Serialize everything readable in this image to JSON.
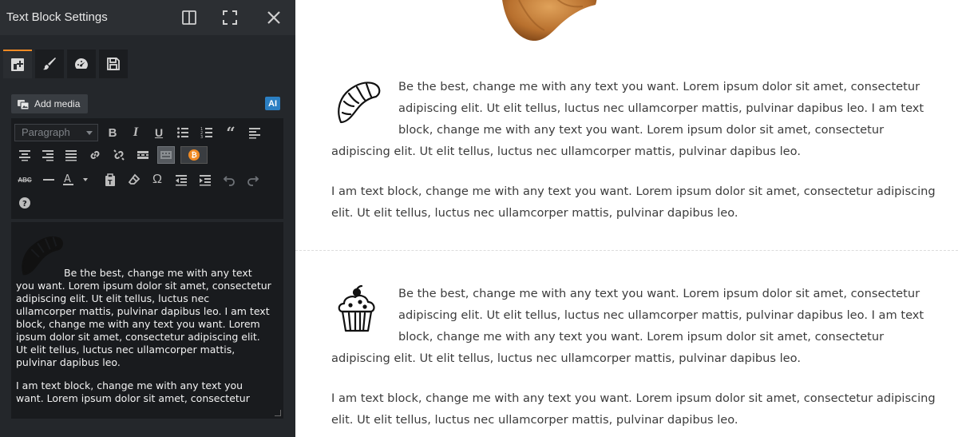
{
  "panel": {
    "title": "Text Block Settings",
    "header_icons": [
      "split-layout-icon",
      "fullscreen-icon",
      "close-icon"
    ],
    "tabs": [
      {
        "name": "general-tab",
        "icon": "layout-plus-icon",
        "active": true
      },
      {
        "name": "design-tab",
        "icon": "brush-icon",
        "active": false
      },
      {
        "name": "responsive-tab",
        "icon": "speedometer-icon",
        "active": false
      },
      {
        "name": "save-tab",
        "icon": "save-icon",
        "active": false
      }
    ],
    "add_media_label": "Add media",
    "ai_label": "AI",
    "format_select": "Paragraph",
    "accent_color": "#f08a24",
    "ai_color": "#2b7fc3"
  },
  "editor": {
    "paragraphs": [
      "Be the best, change me with any text you want. Lorem ipsum dolor sit amet, consectetur adipiscing elit. Ut elit tellus, luctus nec ullamcorper mattis, pulvinar dapibus leo. I am text block, change me with any text you want. Lorem ipsum dolor sit amet, consectetur adipiscing elit. Ut elit tellus, luctus nec ullamcorper mattis, pulvinar dapibus leo.",
      "I am text block, change me with any text you want. Lorem ipsum dolor sit amet, consectetur"
    ]
  },
  "preview": {
    "block1": {
      "p1": "Be the best, change me with any text you want. Lorem ipsum dolor sit amet, consectetur adipiscing elit. Ut elit tellus, luctus nec ullamcorper mattis, pulvinar dapibus leo. I am text block, change me with any text you want. Lorem ipsum dolor sit amet, consectetur adipiscing elit. Ut elit tellus, luctus nec ullamcorper mattis, pulvinar dapibus leo.",
      "p2": "I am text block, change me with any text you want. Lorem ipsum dolor sit amet, consectetur adipiscing elit. Ut elit tellus, luctus nec ullamcorper mattis, pulvinar dapibus leo.",
      "icon": "croissant-icon"
    },
    "block2": {
      "p1": "Be the best, change me with any text you want. Lorem ipsum dolor sit amet, consectetur adipiscing elit. Ut elit tellus, luctus nec ullamcorper mattis, pulvinar dapibus leo. I am text block, change me with any text you want. Lorem ipsum dolor sit amet, consectetur adipiscing elit. Ut elit tellus, luctus nec ullamcorper mattis, pulvinar dapibus leo.",
      "p2": "I am text block, change me with any text you want. Lorem ipsum dolor sit amet, consectetur adipiscing elit. Ut elit tellus, luctus nec ullamcorper mattis, pulvinar dapibus leo.",
      "icon": "cupcake-icon"
    }
  }
}
